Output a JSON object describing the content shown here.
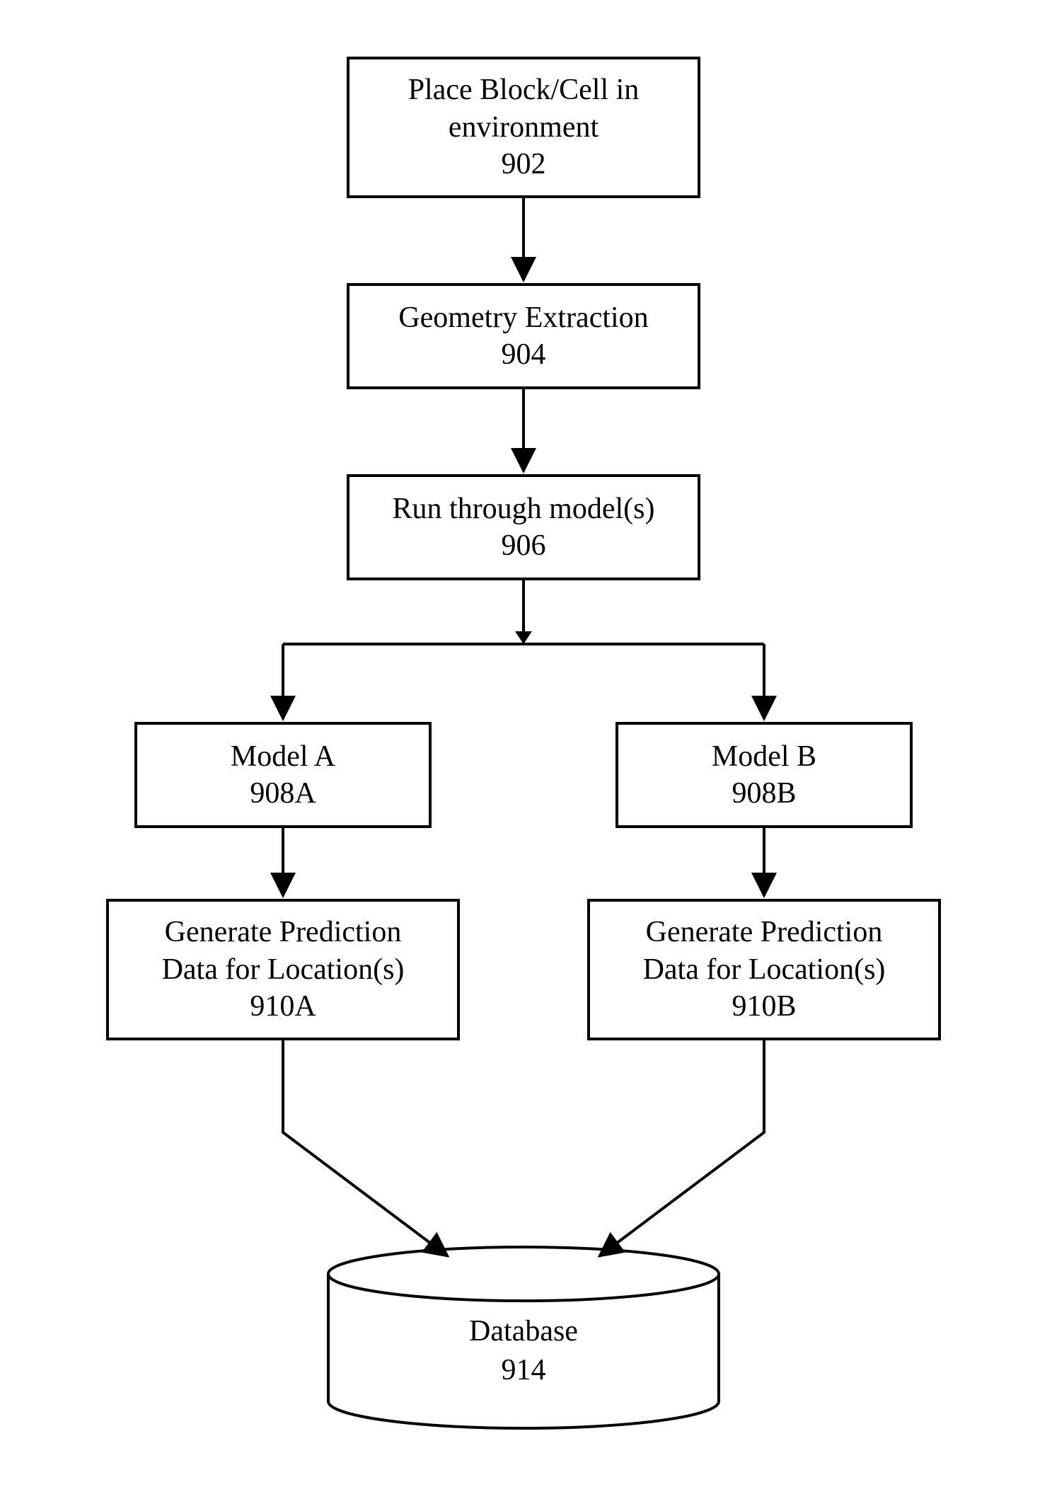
{
  "nodes": {
    "n902": {
      "line1": "Place Block/Cell in",
      "line2": "environment",
      "ref": "902"
    },
    "n904": {
      "line1": "Geometry Extraction",
      "ref": "904"
    },
    "n906": {
      "line1": "Run through model(s)",
      "ref": "906"
    },
    "n908A": {
      "line1": "Model A",
      "ref": "908A"
    },
    "n908B": {
      "line1": "Model B",
      "ref": "908B"
    },
    "n910A": {
      "line1": "Generate Prediction",
      "line2": "Data for Location(s)",
      "ref": "910A"
    },
    "n910B": {
      "line1": "Generate Prediction",
      "line2": "Data for Location(s)",
      "ref": "910B"
    },
    "db": {
      "line1": "Database",
      "ref": "914"
    }
  },
  "chart_data": {
    "type": "table",
    "description": "Flowchart of prediction-data generation process with two parallel model branches feeding a database.",
    "nodes": [
      {
        "id": "902",
        "label": "Place Block/Cell in environment",
        "shape": "rect"
      },
      {
        "id": "904",
        "label": "Geometry Extraction",
        "shape": "rect"
      },
      {
        "id": "906",
        "label": "Run through model(s)",
        "shape": "rect"
      },
      {
        "id": "908A",
        "label": "Model A",
        "shape": "rect"
      },
      {
        "id": "908B",
        "label": "Model B",
        "shape": "rect"
      },
      {
        "id": "910A",
        "label": "Generate Prediction Data for Location(s)",
        "shape": "rect"
      },
      {
        "id": "910B",
        "label": "Generate Prediction Data for Location(s)",
        "shape": "rect"
      },
      {
        "id": "914",
        "label": "Database",
        "shape": "cylinder"
      }
    ],
    "edges": [
      {
        "from": "902",
        "to": "904"
      },
      {
        "from": "904",
        "to": "906"
      },
      {
        "from": "906",
        "to": "908A"
      },
      {
        "from": "906",
        "to": "908B"
      },
      {
        "from": "908A",
        "to": "910A"
      },
      {
        "from": "908B",
        "to": "910B"
      },
      {
        "from": "910A",
        "to": "914"
      },
      {
        "from": "910B",
        "to": "914"
      }
    ]
  }
}
